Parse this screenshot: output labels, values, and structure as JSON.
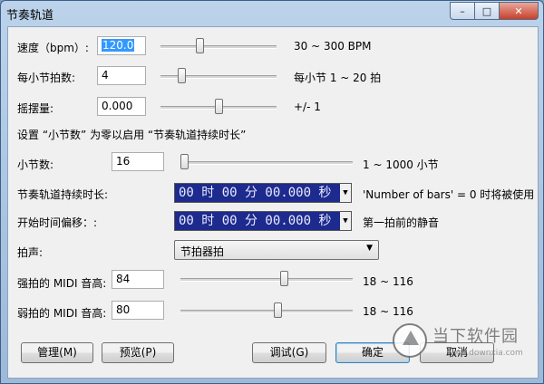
{
  "window": {
    "title": "节奏轨道",
    "buttons": [
      "–",
      "□",
      "✕"
    ]
  },
  "tempo": {
    "label": "速度（bpm）:",
    "value": "120.0",
    "slider_fraction": 0.33,
    "range": "30 ~ 300 BPM"
  },
  "beats_per_bar": {
    "label": "每小节拍数:",
    "value": "4",
    "slider_fraction": 0.16,
    "range": "每小节 1 ~ 20 拍"
  },
  "swing": {
    "label": "摇摆量:",
    "value": "0.000",
    "slider_fraction": 0.5,
    "range": "+/- 1"
  },
  "note": "设置 “小节数” 为零以启用 “节奏轨道持续时长”",
  "bars": {
    "label": "小节数:",
    "value": "16",
    "slider_fraction": 0.0,
    "range": "1 ~ 1000 小节"
  },
  "duration": {
    "label": "节奏轨道持续时长:",
    "value": "00 时 00 分 00.000 秒",
    "hint": "'Number of bars' = 0 时将被使用"
  },
  "offset": {
    "label": "开始时间偏移：:",
    "value": "00 时 00 分 00.000 秒",
    "hint": "第一拍前的静音"
  },
  "click": {
    "label": "拍声:",
    "selected": "节拍器拍"
  },
  "strong_midi": {
    "label": "强拍的 MIDI 音高:",
    "value": "84",
    "slider_fraction": 0.61,
    "range": "18 ~ 116"
  },
  "weak_midi": {
    "label": "弱拍的 MIDI 音高:",
    "value": "80",
    "slider_fraction": 0.57,
    "range": "18 ~ 116"
  },
  "buttons": {
    "manage": "管理(M)",
    "preview": "预览(P)",
    "debug": "调试(G)",
    "ok": "确定",
    "cancel": "取消"
  },
  "watermark": {
    "text": "当下软件园",
    "url": "www.downxia.com"
  }
}
